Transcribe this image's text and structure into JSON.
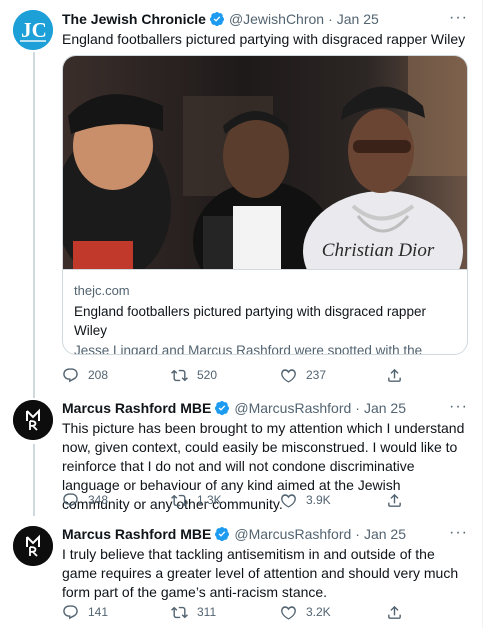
{
  "tweets": [
    {
      "name": "The Jewish Chronicle",
      "handle": "@JewishChron",
      "date": "Jan 25",
      "text": "England footballers pictured partying with disgraced rapper Wiley",
      "avatar_text": "JC",
      "card": {
        "domain": "thejc.com",
        "title": "England footballers pictured partying with disgraced rapper Wiley",
        "description": "Jesse Lingard and Marcus Rashford were spotted with the antisemitic musician in Dubai",
        "shirt_text": "Christian Dior"
      },
      "replies": "208",
      "retweets": "520",
      "likes": "237"
    },
    {
      "name": "Marcus Rashford MBE",
      "handle": "@MarcusRashford",
      "date": "Jan 25",
      "text": "This picture has been brought to my attention which I understand now, given context, could easily be misconstrued. I would like to reinforce that I do not and will not condone discriminative language or behaviour of any kind aimed at the Jewish community or any other community.",
      "replies": "348",
      "retweets": "1.3K",
      "likes": "3.9K"
    },
    {
      "name": "Marcus Rashford MBE",
      "handle": "@MarcusRashford",
      "date": "Jan 25",
      "text": "I truly believe that tackling antisemitism in and outside of the game requires a greater level of attention and should very much form part of the game’s anti-racism stance.",
      "replies": "141",
      "retweets": "311",
      "likes": "3.2K"
    }
  ],
  "colors": {
    "verified": "#1d9bf0",
    "muted": "#536471",
    "text": "#0f1419",
    "border": "#cfd9de",
    "jc_brand": "#1d9fd8"
  },
  "icons": [
    "reply-icon",
    "retweet-icon",
    "like-icon",
    "share-icon",
    "verified-badge-icon",
    "more-icon"
  ]
}
